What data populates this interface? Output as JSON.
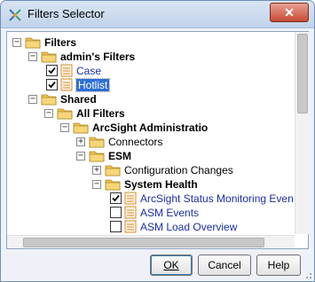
{
  "window": {
    "title": "Filters Selector",
    "close_glyph": "✕"
  },
  "tree": [
    {
      "label": "Filters",
      "expander": "−",
      "node": "folder",
      "bold": true
    },
    {
      "label": "admin's Filters",
      "expander": "−",
      "node": "folder",
      "bold": true
    },
    {
      "label": "Case",
      "checkbox": true,
      "checked": true,
      "node": "filter"
    },
    {
      "label": "Hotlist",
      "checkbox": true,
      "checked": true,
      "node": "filter",
      "selected": true
    },
    {
      "label": "Shared",
      "expander": "−",
      "node": "folder",
      "bold": true
    },
    {
      "label": "All Filters",
      "expander": "−",
      "node": "folder",
      "bold": true
    },
    {
      "label": "ArcSight Administratio",
      "expander": "−",
      "node": "folder",
      "bold": true
    },
    {
      "label": "Connectors",
      "expander": "+",
      "node": "folder"
    },
    {
      "label": "ESM",
      "expander": "−",
      "node": "folder",
      "bold": true
    },
    {
      "label": "Configuration Changes",
      "expander": "+",
      "node": "folder"
    },
    {
      "label": "System Health",
      "expander": "−",
      "node": "folder",
      "bold": true
    },
    {
      "label": "ArcSight Status Monitoring Even",
      "checkbox": true,
      "checked": true,
      "node": "filter"
    },
    {
      "label": "ASM Events",
      "checkbox": true,
      "checked": false,
      "node": "filter"
    },
    {
      "label": "ASM Load Overview",
      "checkbox": true,
      "checked": false,
      "node": "filter"
    }
  ],
  "buttons": {
    "ok_label": "OK",
    "cancel_label": "Cancel",
    "help_label": "Help"
  },
  "colors": {
    "folder": "#f2c14e",
    "filter_icon": "#d98a2b",
    "link": "#1c2fa8",
    "selection": "#2f6fd6"
  },
  "icons": {
    "app": "filters-icon",
    "close": "close-icon",
    "folder": "folder-icon",
    "filter": "filter-document-icon"
  }
}
